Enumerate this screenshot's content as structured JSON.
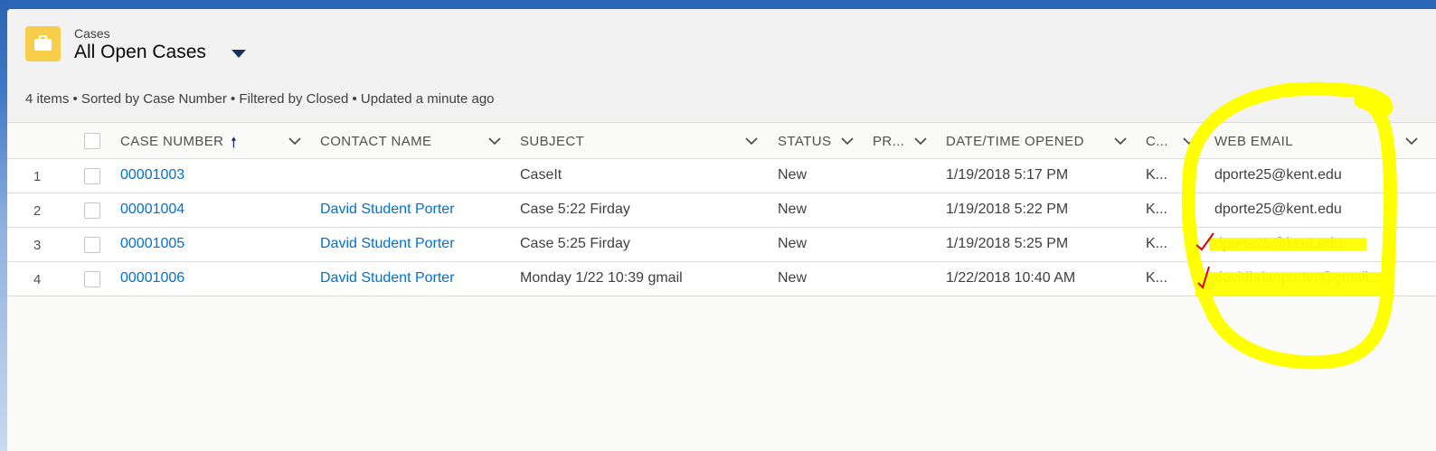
{
  "header": {
    "object_label": "Cases",
    "list_view_title": "All Open Cases",
    "meta": "4 items • Sorted by Case Number • Filtered by Closed • Updated a minute ago"
  },
  "columns": {
    "case_number": "CASE NUMBER",
    "contact_name": "CONTACT NAME",
    "subject": "SUBJECT",
    "status": "STATUS",
    "priority": "PR...",
    "date_opened": "DATE/TIME OPENED",
    "c": "C...",
    "web_email": "WEB EMAIL"
  },
  "rows": [
    {
      "num": "1",
      "case_number": "00001003",
      "contact_name": "",
      "subject": "CaseIt",
      "status": "New",
      "date_opened": "1/19/2018 5:17 PM",
      "c": "K...",
      "web_email": "dporte25@kent.edu"
    },
    {
      "num": "2",
      "case_number": "00001004",
      "contact_name": "David Student Porter",
      "subject": "Case 5:22 Firday",
      "status": "New",
      "date_opened": "1/19/2018 5:22 PM",
      "c": "K...",
      "web_email": "dporte25@kent.edu"
    },
    {
      "num": "3",
      "case_number": "00001005",
      "contact_name": "David Student Porter",
      "subject": "Case 5:25 Firday",
      "status": "New",
      "date_opened": "1/19/2018 5:25 PM",
      "c": "K...",
      "web_email": "dporte25@kent.edu"
    },
    {
      "num": "4",
      "case_number": "00001006",
      "contact_name": "David Student Porter",
      "subject": "Monday 1/22 10:39 gmail",
      "status": "New",
      "date_opened": "1/22/2018 10:40 AM",
      "c": "K...",
      "web_email": "davidbrianporter@gmail...."
    }
  ],
  "colors": {
    "link": "#0070d2",
    "highlight": "#ffff00",
    "checkmark": "#e00000",
    "object_icon": "#f7cd4a"
  }
}
